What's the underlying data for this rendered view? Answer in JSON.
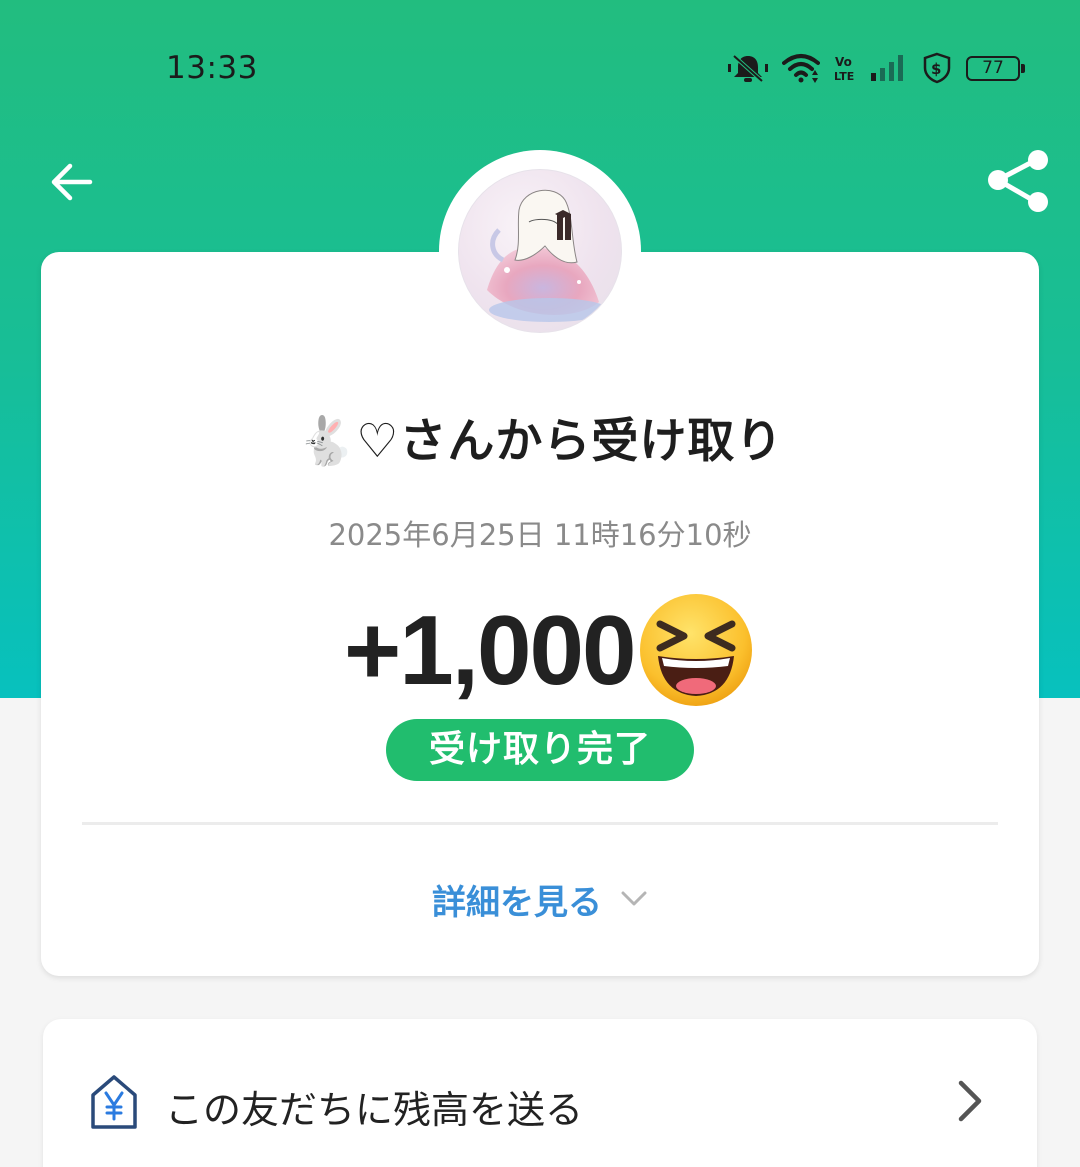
{
  "status_bar": {
    "time": "13:33",
    "battery": "77",
    "icons": [
      "mute-icon",
      "wifi-icon",
      "volte-icon",
      "signal-icon",
      "security-shield-icon",
      "battery-icon"
    ]
  },
  "header": {
    "back_icon": "arrow-left-icon",
    "share_icon": "share-icon",
    "colors": {
      "gradient_top": "#22bd7f",
      "gradient_bottom": "#07c1be"
    }
  },
  "transaction": {
    "title": "🐇♡さんから受け取り",
    "datetime": "2025年6月25日 11時16分10秒",
    "amount": "+1,000",
    "amount_emoji": "grinning-squinting-face",
    "status": "受け取り完了",
    "status_color": "#21bd6e",
    "details_label": "詳細を見る",
    "details_color": "#3a8fd8"
  },
  "actions": {
    "send_balance_label": "この友だちに残高を送る",
    "send_balance_icon": "yen-house-icon"
  }
}
